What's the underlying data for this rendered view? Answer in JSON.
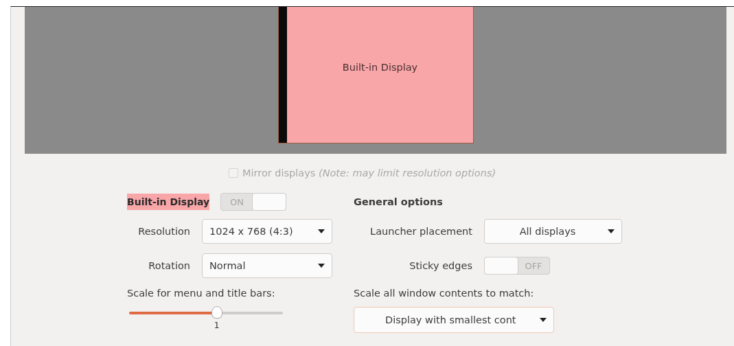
{
  "preview": {
    "monitor_label": "Built-in Display"
  },
  "mirror": {
    "label": "Mirror displays",
    "note": "(Note: may limit resolution options)",
    "checked": false,
    "disabled": true
  },
  "display": {
    "name": "Built-in Display",
    "switch": {
      "on": true,
      "label": "ON"
    },
    "fields": [
      {
        "label": "Resolution",
        "value": "1024 x 768 (4:3)"
      },
      {
        "label": "Rotation",
        "value": "Normal"
      }
    ],
    "scale": {
      "label": "Scale for menu and title bars:",
      "level": 0.57,
      "value": "1"
    }
  },
  "general": {
    "title": "General options",
    "launcher": {
      "label": "Launcher placement",
      "value": "All displays"
    },
    "sticky": {
      "label": "Sticky edges",
      "on": false,
      "label_off": "OFF"
    },
    "scale_all": {
      "label": "Scale all window contents to match:",
      "value": "Display with smallest cont"
    }
  }
}
